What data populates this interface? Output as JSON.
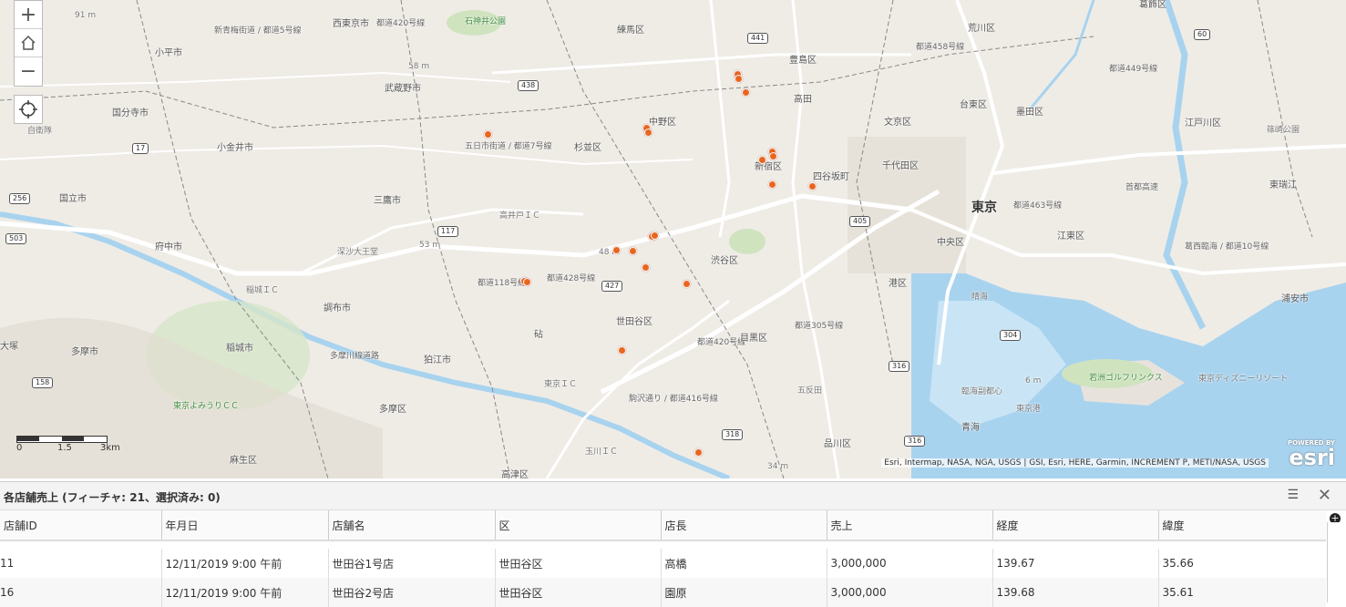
{
  "map": {
    "labels": [
      {
        "text": "91 m",
        "cls": "small"
      },
      {
        "text": "新青梅街道 / 都道5号線",
        "cls": "route"
      },
      {
        "text": "西東京市",
        "cls": ""
      },
      {
        "text": "石神井公園",
        "cls": "green"
      },
      {
        "text": "練馬区",
        "cls": ""
      },
      {
        "text": "都道420号線",
        "cls": "route"
      },
      {
        "text": "豊島区",
        "cls": ""
      },
      {
        "text": "荒川区",
        "cls": ""
      },
      {
        "text": "葛飾区",
        "cls": ""
      },
      {
        "text": "小平市",
        "cls": ""
      },
      {
        "text": "58 m",
        "cls": "small"
      },
      {
        "text": "武蔵野市",
        "cls": ""
      },
      {
        "text": "高田",
        "cls": ""
      },
      {
        "text": "都道458号線",
        "cls": "route"
      },
      {
        "text": "都道449号線",
        "cls": "route"
      },
      {
        "text": "国分寺市",
        "cls": ""
      },
      {
        "text": "中野区",
        "cls": ""
      },
      {
        "text": "文京区",
        "cls": ""
      },
      {
        "text": "台東区",
        "cls": ""
      },
      {
        "text": "墨田区",
        "cls": ""
      },
      {
        "text": "江戸川区",
        "cls": ""
      },
      {
        "text": "自衛隊",
        "cls": "small"
      },
      {
        "text": "篠崎公園",
        "cls": "small"
      },
      {
        "text": "五日市街道 / 都道7号線",
        "cls": "route"
      },
      {
        "text": "小金井市",
        "cls": ""
      },
      {
        "text": "杉並区",
        "cls": ""
      },
      {
        "text": "新宿区",
        "cls": ""
      },
      {
        "text": "四谷坂町",
        "cls": ""
      },
      {
        "text": "千代田区",
        "cls": ""
      },
      {
        "text": "国立市",
        "cls": ""
      },
      {
        "text": "三鷹市",
        "cls": ""
      },
      {
        "text": "東瑞江",
        "cls": ""
      },
      {
        "text": "高井戸ＩＣ",
        "cls": "small"
      },
      {
        "text": "東京",
        "cls": "big"
      },
      {
        "text": "都道463号線",
        "cls": "route"
      },
      {
        "text": "首都高速",
        "cls": "route"
      },
      {
        "text": "府中市",
        "cls": ""
      },
      {
        "text": "深沙大王堂",
        "cls": "small"
      },
      {
        "text": "53 m",
        "cls": "small"
      },
      {
        "text": "48 m",
        "cls": "small"
      },
      {
        "text": "中央区",
        "cls": ""
      },
      {
        "text": "江東区",
        "cls": ""
      },
      {
        "text": "葛西臨海 / 都道10号線",
        "cls": "route"
      },
      {
        "text": "渋谷区",
        "cls": ""
      },
      {
        "text": "都道118号線",
        "cls": "route"
      },
      {
        "text": "都道428号線",
        "cls": "route"
      },
      {
        "text": "浦安市",
        "cls": ""
      },
      {
        "text": "稲城ＩＣ",
        "cls": "small"
      },
      {
        "text": "港区",
        "cls": ""
      },
      {
        "text": "晴海",
        "cls": "small"
      },
      {
        "text": "調布市",
        "cls": ""
      },
      {
        "text": "世田谷区",
        "cls": ""
      },
      {
        "text": "都道305号線",
        "cls": "route"
      },
      {
        "text": "大塚",
        "cls": ""
      },
      {
        "text": "砧",
        "cls": ""
      },
      {
        "text": "都道420号線",
        "cls": "route"
      },
      {
        "text": "目黒区",
        "cls": ""
      },
      {
        "text": "多摩市",
        "cls": ""
      },
      {
        "text": "稲城市",
        "cls": ""
      },
      {
        "text": "多摩川線道路",
        "cls": "route"
      },
      {
        "text": "狛江市",
        "cls": ""
      },
      {
        "text": "6 m",
        "cls": "small"
      },
      {
        "text": "若洲ゴルフリンクス",
        "cls": "green"
      },
      {
        "text": "東京ディズニーリゾート",
        "cls": "small"
      },
      {
        "text": "東京ＩＣ",
        "cls": "small"
      },
      {
        "text": "駒沢通り / 都道416号線",
        "cls": "route"
      },
      {
        "text": "五反田",
        "cls": "small"
      },
      {
        "text": "臨海副都心",
        "cls": "small"
      },
      {
        "text": "東京港",
        "cls": "small"
      },
      {
        "text": "東京よみうりＣＣ",
        "cls": "green"
      },
      {
        "text": "多摩区",
        "cls": ""
      },
      {
        "text": "青海",
        "cls": ""
      },
      {
        "text": "品川区",
        "cls": ""
      },
      {
        "text": "玉川ＩＣ",
        "cls": "small"
      },
      {
        "text": "麻生区",
        "cls": ""
      },
      {
        "text": "34 m",
        "cls": "small"
      },
      {
        "text": "高津区",
        "cls": ""
      }
    ],
    "shields": [
      "438",
      "441",
      "60",
      "17",
      "256",
      "117",
      "405",
      "503",
      "427",
      "304",
      "316",
      "158",
      "318",
      "316"
    ],
    "point_count": 21,
    "point_color": "#e8661e",
    "scale": {
      "zero": "0",
      "mid": "1.5",
      "end": "3km"
    },
    "attribution": "Esri, Intermap, NASA, NGA, USGS | GSI, Esri, HERE, Garmin, INCREMENT P, METI/NASA, USGS",
    "logo_powered": "POWERED BY",
    "logo_brand": "esri",
    "controls": {
      "zoom_in": "+",
      "home": "⌂",
      "zoom_out": "−"
    }
  },
  "table": {
    "title": "各店舗売上 (フィーチャ: 21、選択済み: 0)",
    "menu_icon": "☰",
    "close_icon": "✕",
    "columns": [
      "店舗ID",
      "年月日",
      "店舗名",
      "区",
      "店長",
      "売上",
      "経度",
      "緯度"
    ],
    "rows": [
      [
        "11",
        "12/11/2019 9:00 午前",
        "世田谷1号店",
        "世田谷区",
        "高橋",
        "3,000,000",
        "139.67",
        "35.66"
      ],
      [
        "16",
        "12/11/2019 9:00 午前",
        "世田谷2号店",
        "世田谷区",
        "園原",
        "3,000,000",
        "139.68",
        "35.61"
      ]
    ]
  }
}
